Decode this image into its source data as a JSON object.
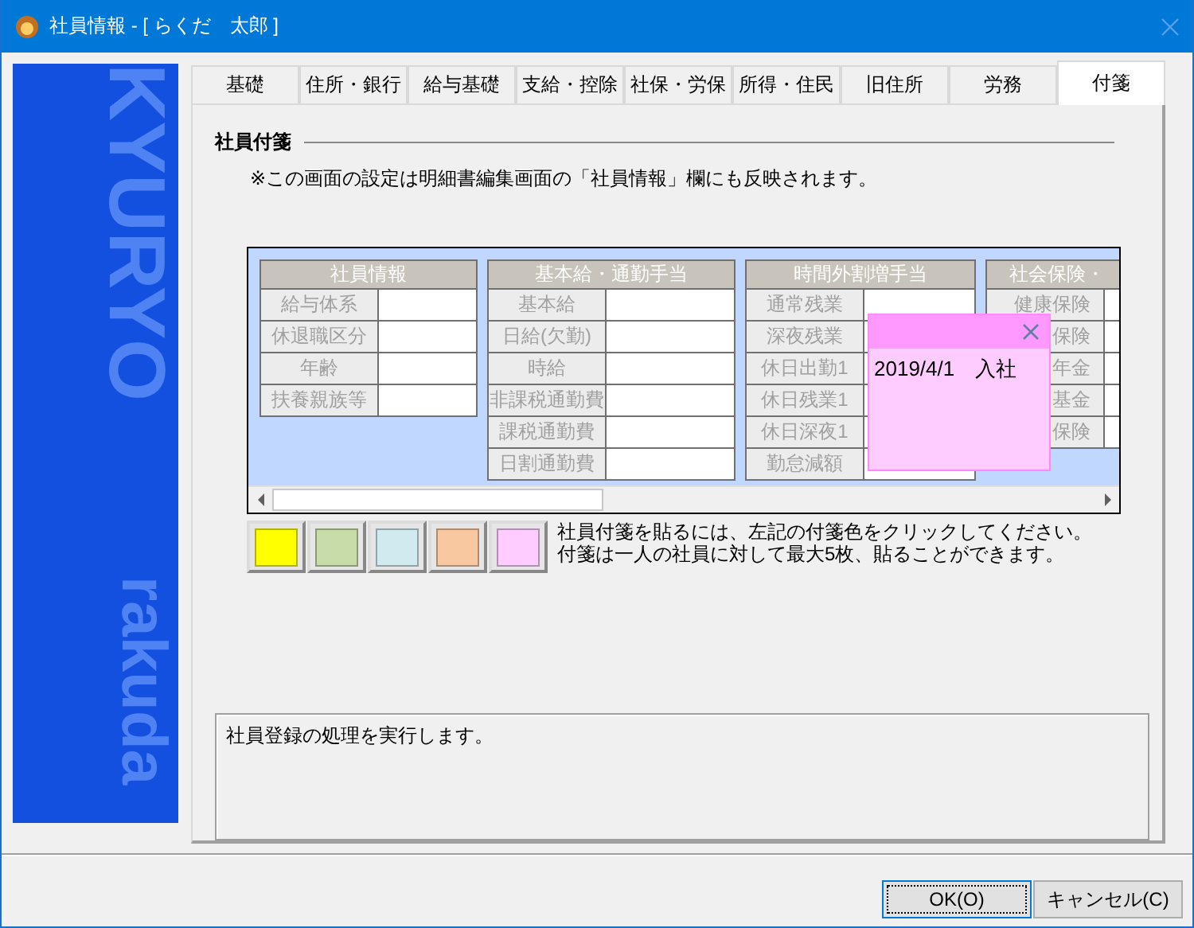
{
  "window": {
    "title": "社員情報 - [ らくだ　太郎 ]"
  },
  "sidebar": {
    "logo_texts": [
      "KYURYO",
      "rakuda"
    ]
  },
  "tabs": [
    {
      "label": "基礎",
      "selected": false
    },
    {
      "label": "住所・銀行",
      "selected": false
    },
    {
      "label": "給与基礎",
      "selected": false
    },
    {
      "label": "支給・控除",
      "selected": false
    },
    {
      "label": "社保・労保",
      "selected": false
    },
    {
      "label": "所得・住民",
      "selected": false
    },
    {
      "label": "旧住所",
      "selected": false
    },
    {
      "label": "労務",
      "selected": false
    },
    {
      "label": "付箋",
      "selected": true
    }
  ],
  "section": {
    "title": "社員付箋",
    "note": "※この画面の設定は明細書編集画面の「社員情報」欄にも反映されます。"
  },
  "preview": {
    "groups": [
      {
        "header": "社員情報",
        "partial": false,
        "rows": [
          {
            "label": "給与体系"
          },
          {
            "label": "休退職区分"
          },
          {
            "label": "年齢"
          },
          {
            "label": "扶養親族等"
          }
        ]
      },
      {
        "header": "基本給・通勤手当",
        "partial": false,
        "rows": [
          {
            "label": "基本給"
          },
          {
            "label": "日給(欠勤)"
          },
          {
            "label": "時給"
          },
          {
            "label": "非課税通勤費"
          },
          {
            "label": "課税通勤費"
          },
          {
            "label": "日割通勤費"
          }
        ]
      },
      {
        "header": "時間外割増手当",
        "partial": false,
        "rows": [
          {
            "label": "通常残業"
          },
          {
            "label": "深夜残業"
          },
          {
            "label": "休日出勤1"
          },
          {
            "label": "休日残業1"
          },
          {
            "label": "休日深夜1"
          },
          {
            "label": "勤怠減額"
          }
        ]
      },
      {
        "header": "社会保険・",
        "partial": true,
        "rows": [
          {
            "label": "健康保険"
          },
          {
            "label": "保険"
          },
          {
            "label": "年金"
          },
          {
            "label": "基金"
          },
          {
            "label": "保険"
          }
        ]
      }
    ],
    "sticky_note": {
      "text": "2019/4/1　入社",
      "color": "#ffccff"
    }
  },
  "color_swatches": [
    {
      "color": "#ffff00"
    },
    {
      "color": "#c8dca8"
    },
    {
      "color": "#d0eaf0"
    },
    {
      "color": "#f8c8a0"
    },
    {
      "color": "#ffccff"
    }
  ],
  "instructions": [
    "社員付箋を貼るには、左記の付箋色をクリックしてください。",
    "付箋は一人の社員に対して最大5枚、貼ることができます。"
  ],
  "message": "社員登録の処理を実行します。",
  "buttons": [
    {
      "label": "OK(O)",
      "focused": true
    },
    {
      "label": "キャンセル(C)",
      "focused": false
    }
  ]
}
